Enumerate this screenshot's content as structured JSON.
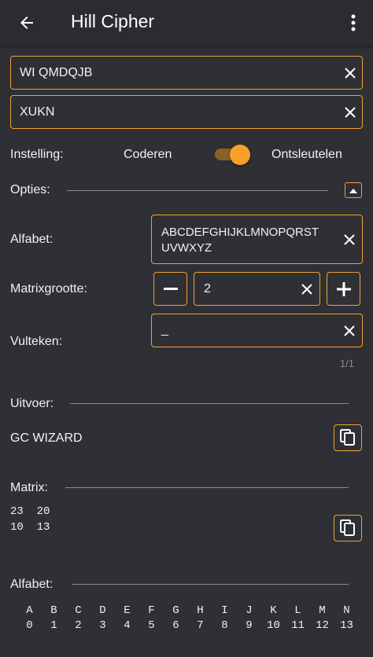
{
  "appbar": {
    "title": "Hill Cipher",
    "back_icon": "arrow-left-icon",
    "menu_icon": "more-vert-icon"
  },
  "input": {
    "text_value": "WI QMDQJB",
    "key_value": "XUKN"
  },
  "mode": {
    "label": "Instelling:",
    "left_option": "Coderen",
    "right_option": "Ontsleutelen",
    "selected": "Ontsleutelen"
  },
  "options": {
    "label": "Opties:",
    "alphabet_label": "Alfabet:",
    "alphabet_line1": "ABCDEFGHIJKLMNOPQRST",
    "alphabet_line2": "UVWXYZ",
    "matrix_size_label": "Matrixgrootte:",
    "matrix_size_value": "2",
    "fill_char_label": "Vulteken:",
    "fill_char_value": "_",
    "counter": "1/1"
  },
  "output": {
    "label": "Uitvoer:",
    "value": "GC WIZARD"
  },
  "matrix": {
    "label": "Matrix:",
    "row1": "23  20",
    "row2": "10  13"
  },
  "alphabet_table": {
    "label": "Alfabet:",
    "letters": [
      "A",
      "B",
      "C",
      "D",
      "E",
      "F",
      "G",
      "H",
      "I",
      "J",
      "K",
      "L",
      "M",
      "N"
    ],
    "numbers": [
      "0",
      "1",
      "2",
      "3",
      "4",
      "5",
      "6",
      "7",
      "8",
      "9",
      "10",
      "11",
      "12",
      "13"
    ]
  },
  "colors": {
    "background": "#2f3035",
    "accent": "#f0a12e",
    "text": "#f2f2f2"
  }
}
